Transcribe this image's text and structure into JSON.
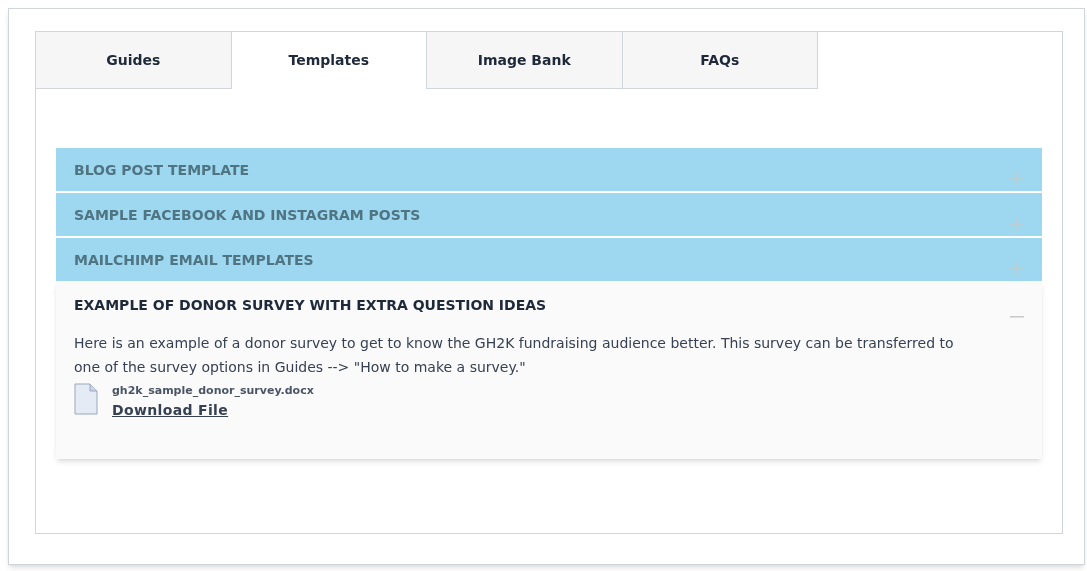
{
  "tabs": [
    {
      "label": "Guides",
      "selected": false
    },
    {
      "label": "Templates",
      "selected": true
    },
    {
      "label": "Image Bank",
      "selected": false
    },
    {
      "label": "FAQs",
      "selected": false
    }
  ],
  "sections": [
    {
      "title": "BLOG POST TEMPLATE",
      "expanded": false
    },
    {
      "title": "SAMPLE FACEBOOK AND INSTAGRAM POSTS",
      "expanded": false
    },
    {
      "title": "MAILCHIMP EMAIL TEMPLATES",
      "expanded": false
    },
    {
      "title": "EXAMPLE OF DONOR SURVEY WITH EXTRA QUESTION IDEAS",
      "expanded": true,
      "body": "Here is an example of a donor survey to get to know the GH2K fundraising audience better. This survey can be transferred to one of the survey options in Guides --> \"How to make a survey.\"",
      "file": {
        "name": "gh2k_sample_donor_survey.docx",
        "link": "Download File"
      }
    }
  ]
}
